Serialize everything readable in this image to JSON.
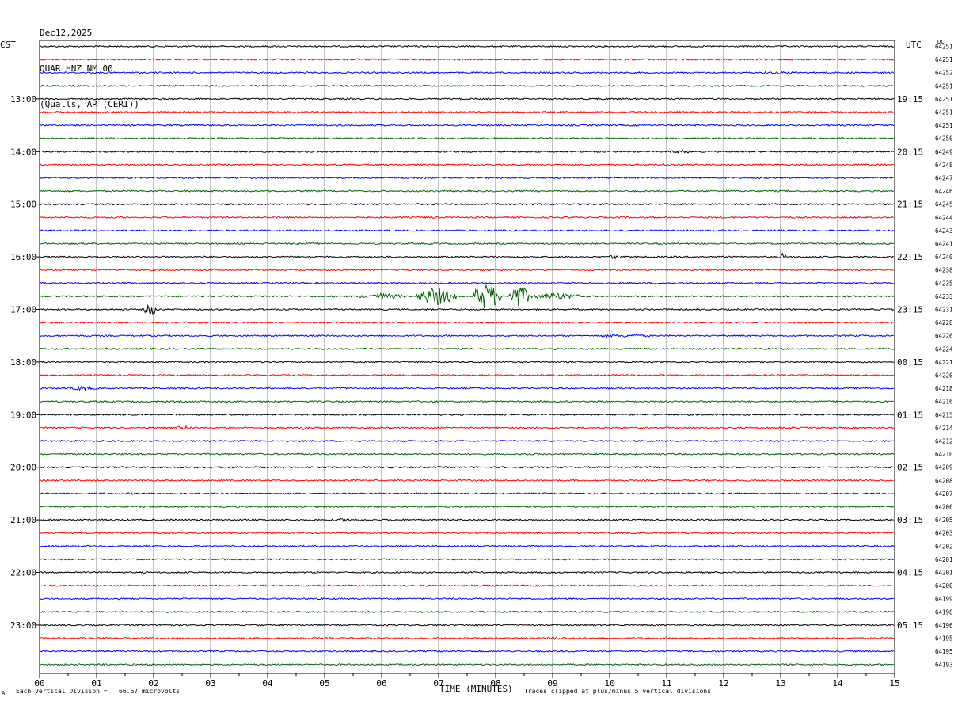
{
  "header": {
    "date": "Dec12,2025",
    "station": "QUAR HNZ NM 00",
    "location": "(Qualls, AR (CERI))"
  },
  "left_tz": "CST",
  "right_tz": "UTC",
  "dc_label": "DC",
  "footer": {
    "scale": "Each Vertical Division =   66.67 microvolts",
    "xaxis_title": "TIME (MINUTES)",
    "clip_note": "Traces clipped at plus/minus 5 vertical divisions",
    "logo": "A"
  },
  "colors": {
    "trace_cycle": [
      "#000000",
      "#ff0000",
      "#0000ff",
      "#006400"
    ],
    "grid": "#888888"
  },
  "chart_data": {
    "type": "line",
    "subtype": "helicorder",
    "minutes_per_line": 15,
    "x_range": [
      0,
      15
    ],
    "x_tick_labels": [
      "00",
      "01",
      "02",
      "03",
      "04",
      "05",
      "06",
      "07",
      "08",
      "09",
      "10",
      "11",
      "12",
      "13",
      "14",
      "15"
    ],
    "left_hour_labels": [
      {
        "line": 4,
        "label": "13:00"
      },
      {
        "line": 8,
        "label": "14:00"
      },
      {
        "line": 12,
        "label": "15:00"
      },
      {
        "line": 16,
        "label": "16:00"
      },
      {
        "line": 20,
        "label": "17:00"
      },
      {
        "line": 24,
        "label": "18:00"
      },
      {
        "line": 28,
        "label": "19:00"
      },
      {
        "line": 32,
        "label": "20:00"
      },
      {
        "line": 36,
        "label": "21:00"
      },
      {
        "line": 40,
        "label": "22:00"
      },
      {
        "line": 44,
        "label": "23:00"
      }
    ],
    "right_hour_labels": [
      {
        "line": 4,
        "label": "19:15"
      },
      {
        "line": 8,
        "label": "20:15"
      },
      {
        "line": 12,
        "label": "21:15"
      },
      {
        "line": 16,
        "label": "22:15"
      },
      {
        "line": 20,
        "label": "23:15"
      },
      {
        "line": 24,
        "label": "00:15"
      },
      {
        "line": 28,
        "label": "01:15"
      },
      {
        "line": 32,
        "label": "02:15"
      },
      {
        "line": 36,
        "label": "03:15"
      },
      {
        "line": 40,
        "label": "04:15"
      },
      {
        "line": 44,
        "label": "05:15"
      }
    ],
    "dc_offsets": [
      "64251",
      "64251",
      "64252",
      "64251",
      "64251",
      "64251",
      "64251",
      "64250",
      "64249",
      "64248",
      "64247",
      "64246",
      "64245",
      "64244",
      "64243",
      "64241",
      "64240",
      "64238",
      "64235",
      "64233",
      "64231",
      "64228",
      "64226",
      "64224",
      "64221",
      "64220",
      "64218",
      "64216",
      "64215",
      "64214",
      "64212",
      "64210",
      "64209",
      "64208",
      "64207",
      "64206",
      "64205",
      "64203",
      "64202",
      "64201",
      "64201",
      "64200",
      "64199",
      "64198",
      "64196",
      "64195",
      "64195",
      "64193"
    ],
    "events": [
      {
        "line": 2,
        "start": 12.2,
        "end": 13.8,
        "amp": 1.5
      },
      {
        "line": 8,
        "start": 10.9,
        "end": 11.6,
        "amp": 2.0
      },
      {
        "line": 13,
        "start": 4.0,
        "end": 4.3,
        "amp": 2.0
      },
      {
        "line": 13,
        "start": 6.5,
        "end": 7.2,
        "amp": 1.5
      },
      {
        "line": 16,
        "start": 9.9,
        "end": 10.3,
        "amp": 2.5
      },
      {
        "line": 16,
        "start": 13.0,
        "end": 13.1,
        "amp": 6.0
      },
      {
        "line": 19,
        "start": 5.6,
        "end": 6.4,
        "amp": 4.0
      },
      {
        "line": 19,
        "start": 6.6,
        "end": 7.3,
        "amp": 12.0
      },
      {
        "line": 19,
        "start": 7.6,
        "end": 8.1,
        "amp": 18.0
      },
      {
        "line": 19,
        "start": 8.2,
        "end": 8.6,
        "amp": 15.0
      },
      {
        "line": 19,
        "start": 8.6,
        "end": 9.5,
        "amp": 5.0
      },
      {
        "line": 20,
        "start": 1.8,
        "end": 2.1,
        "amp": 7.0
      },
      {
        "line": 22,
        "start": 9.6,
        "end": 10.9,
        "amp": 2.0
      },
      {
        "line": 26,
        "start": 0.5,
        "end": 1.0,
        "amp": 3.0
      },
      {
        "line": 29,
        "start": 2.3,
        "end": 2.8,
        "amp": 2.5
      },
      {
        "line": 29,
        "start": 4.6,
        "end": 4.65,
        "amp": 4.0
      },
      {
        "line": 36,
        "start": 5.1,
        "end": 5.6,
        "amp": 2.0
      },
      {
        "line": 45,
        "start": 8.8,
        "end": 9.3,
        "amp": 2.0
      }
    ]
  }
}
